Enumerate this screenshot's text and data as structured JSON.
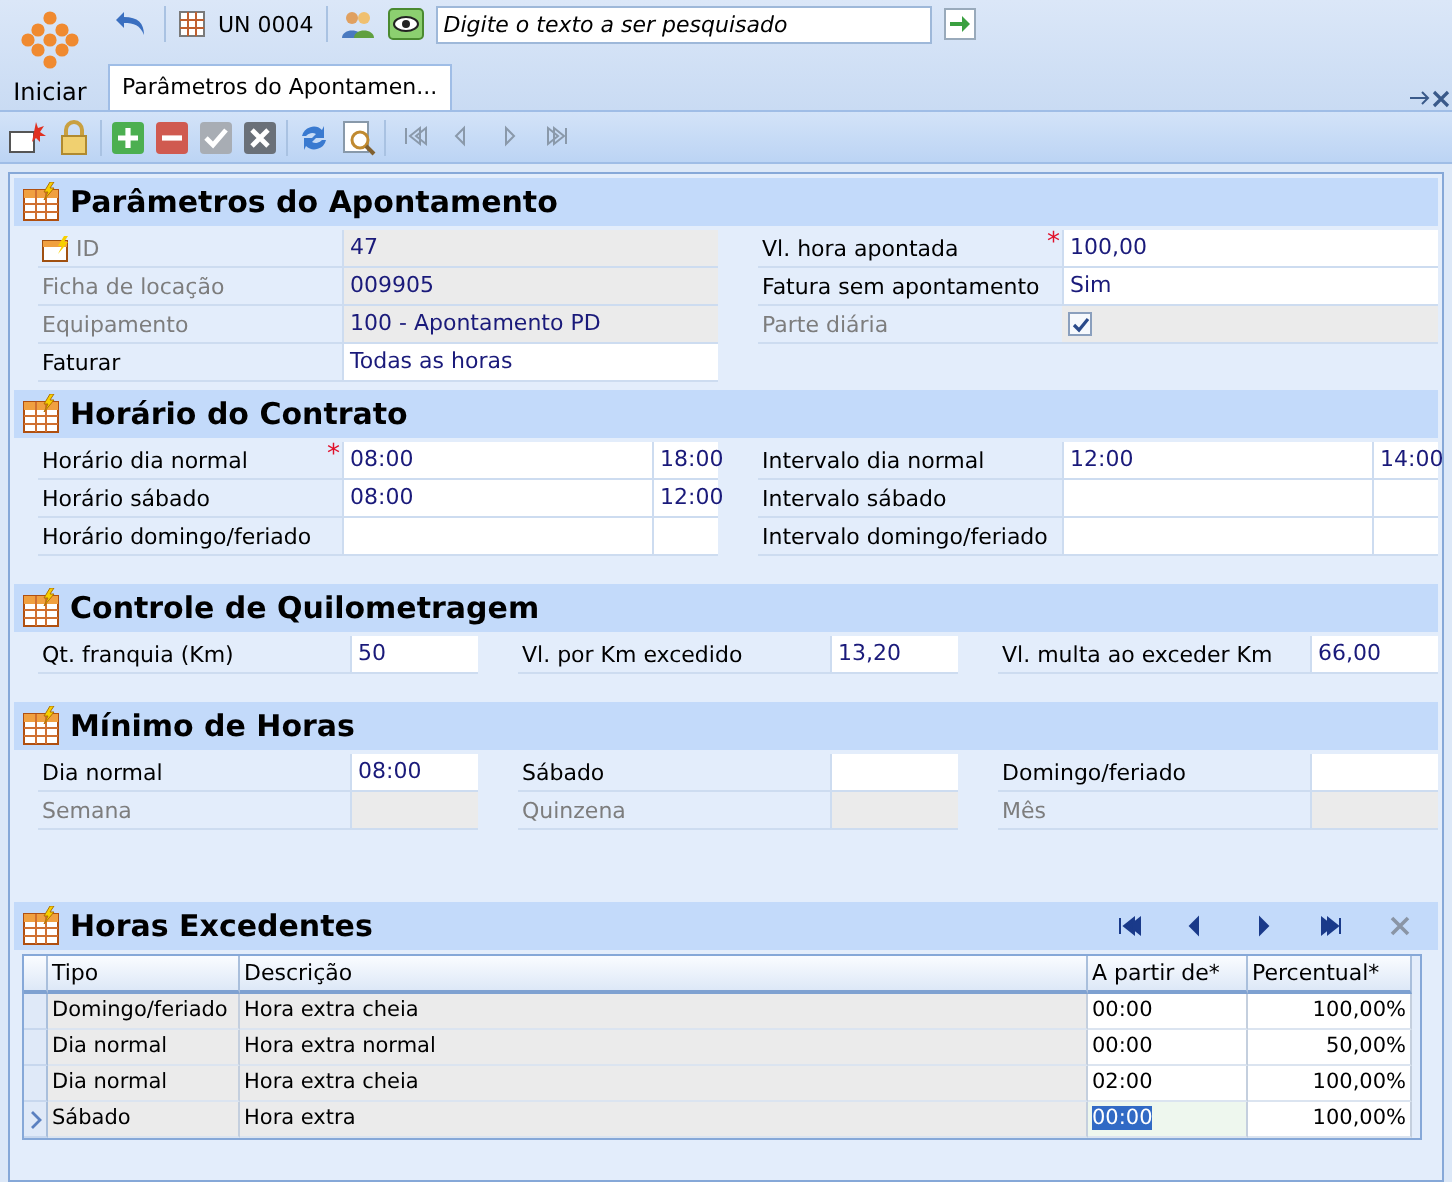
{
  "start_button": {
    "label": "Iniciar"
  },
  "quick_bar": {
    "unit": "UN 0004",
    "search": {
      "placeholder": "Digite o texto a ser pesquisado"
    }
  },
  "tabs": [
    {
      "label": "Parâmetros do Apontamen...",
      "selected": true
    }
  ],
  "sections": [
    {
      "kind": "form",
      "title": "Parâmetros do Apontamento",
      "columns": [
        [
          {
            "kind": "key",
            "label": "ID",
            "value": "47",
            "readonly": true
          },
          {
            "kind": "text",
            "label": "Ficha de locação",
            "value": "009905",
            "readonly": true
          },
          {
            "kind": "text",
            "label": "Equipamento",
            "value": "100 - Apontamento PD",
            "readonly": true
          },
          {
            "kind": "text",
            "label": "Faturar",
            "value": "Todas as horas",
            "readonly": false
          }
        ],
        [
          {
            "kind": "text",
            "label": "Vl. hora apontada",
            "required_mark": "*",
            "value": "100,00",
            "readonly": false
          },
          {
            "kind": "text",
            "label": "Fatura sem apontamento",
            "value": "Sim",
            "readonly": false
          },
          {
            "kind": "check",
            "label": "Parte diária",
            "readonly": true,
            "checked": true
          }
        ]
      ]
    },
    {
      "kind": "form",
      "title": "Horário do Contrato",
      "columns": [
        [
          {
            "kind": "range",
            "label": "Horário dia normal",
            "required_mark": "*",
            "value": "08:00",
            "value_end": "18:00",
            "readonly": false
          },
          {
            "kind": "range",
            "label": "Horário sábado",
            "value": "08:00",
            "value_end": "12:00",
            "readonly": false
          },
          {
            "kind": "range",
            "label": "Horário domingo/feriado",
            "readonly": false
          }
        ],
        [
          {
            "kind": "range",
            "label": "Intervalo dia normal",
            "value": "12:00",
            "value_end": "14:00",
            "readonly": false
          },
          {
            "kind": "range",
            "label": "Intervalo sábado",
            "readonly": false
          },
          {
            "kind": "range",
            "label": "Intervalo domingo/feriado",
            "readonly": false
          }
        ]
      ]
    },
    {
      "kind": "form",
      "title": "Controle de Quilometragem",
      "columns": [
        [
          {
            "kind": "text",
            "label": "Qt. franquia (Km)",
            "value": "50",
            "readonly": false
          }
        ],
        [
          {
            "kind": "text",
            "label": "Vl. por Km excedido",
            "value": "13,20",
            "readonly": false
          }
        ],
        [
          {
            "kind": "text",
            "label": "Vl. multa ao exceder Km",
            "value": "66,00",
            "readonly": false
          }
        ]
      ]
    },
    {
      "kind": "form",
      "title": "Mínimo de Horas",
      "columns": [
        [
          {
            "kind": "text",
            "label": "Dia normal",
            "value": "08:00",
            "readonly": false
          },
          {
            "kind": "text",
            "label": "Semana",
            "readonly": true
          }
        ],
        [
          {
            "kind": "text",
            "label": "Sábado",
            "readonly": false
          },
          {
            "kind": "text",
            "label": "Quinzena",
            "readonly": true
          }
        ],
        [
          {
            "kind": "text",
            "label": "Domingo/feriado",
            "readonly": false
          },
          {
            "kind": "text",
            "label": "Mês",
            "readonly": true
          }
        ]
      ]
    },
    {
      "kind": "grid",
      "title": "Horas Excedentes",
      "grid_columns": [
        {
          "kind": "text",
          "label": "Tipo",
          "readonly": true
        },
        {
          "kind": "text",
          "label": "Descrição",
          "readonly": true
        },
        {
          "kind": "text",
          "label": "A partir de*",
          "readonly": false
        },
        {
          "kind": "number",
          "label": "Percentual*",
          "readonly": false
        }
      ],
      "rows": [
        {
          "cells": [
            "Domingo/feriado",
            "Hora extra cheia",
            "00:00",
            "100,00%"
          ],
          "selected": false
        },
        {
          "cells": [
            "Dia normal",
            "Hora extra normal",
            "00:00",
            "50,00%"
          ],
          "selected": false
        },
        {
          "cells": [
            "Dia normal",
            "Hora extra cheia",
            "02:00",
            "100,00%"
          ],
          "selected": false
        },
        {
          "cells": [
            "Sábado",
            "Hora extra",
            "00:00",
            "100,00%"
          ],
          "selected": true
        }
      ]
    }
  ]
}
